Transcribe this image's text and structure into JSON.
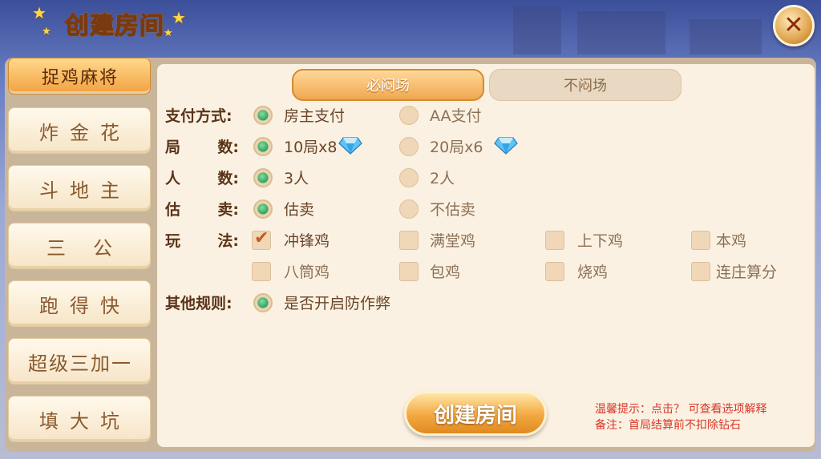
{
  "header": {
    "title": "创建房间"
  },
  "sidebar": {
    "active": "捉鸡麻将",
    "items": [
      "炸金花",
      "斗地主",
      "三公",
      "跑得快",
      "超级三加一",
      "填大坑"
    ]
  },
  "tabs": {
    "active": "必闷场",
    "inactive": "不闷场"
  },
  "rows": {
    "pay": {
      "label": "支付方式:",
      "opt1": "房主支付",
      "opt2": "AA支付"
    },
    "rounds": {
      "label1": "局",
      "label2": "数:",
      "opt1": "10局x8",
      "opt2": "20局x6"
    },
    "players": {
      "label1": "人",
      "label2": "数:",
      "opt1": "3人",
      "opt2": "2人"
    },
    "sell": {
      "label1": "估",
      "label2": "卖:",
      "opt1": "估卖",
      "opt2": "不估卖"
    },
    "play": {
      "label1": "玩",
      "label2": "法:",
      "opts": [
        "冲锋鸡",
        "满堂鸡",
        "上下鸡",
        "本鸡",
        "八筒鸡",
        "包鸡",
        "烧鸡",
        "连庄算分"
      ]
    },
    "other": {
      "label": "其他规则:",
      "opt1": "是否开启防作弊"
    }
  },
  "create_button": "创建房间",
  "hint": {
    "line1": "温馨提示：点击？ 可查看选项解释",
    "line2": "备注：首局结算前不扣除钻石"
  },
  "colors": {
    "accent": "#f2a040",
    "radio_on": "#2f9d5a",
    "hint": "#d8382a"
  }
}
